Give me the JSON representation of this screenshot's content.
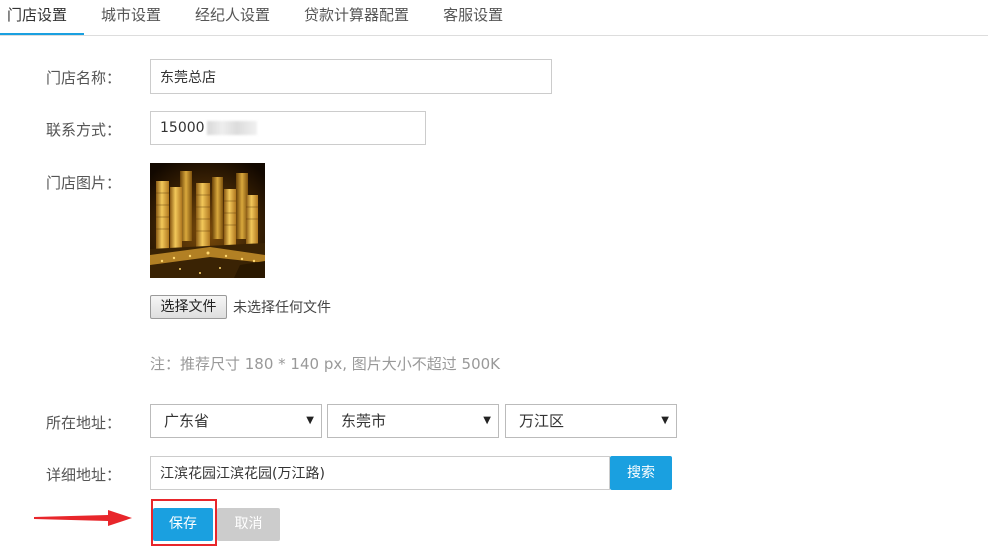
{
  "tabs": [
    {
      "label": "门店设置",
      "active": true
    },
    {
      "label": "城市设置",
      "active": false
    },
    {
      "label": "经纪人设置",
      "active": false
    },
    {
      "label": "贷款计算器配置",
      "active": false
    },
    {
      "label": "客服设置",
      "active": false
    }
  ],
  "form": {
    "store_name": {
      "label": "门店名称：",
      "value": "东莞总店"
    },
    "contact": {
      "label": "联系方式：",
      "value": "15000"
    },
    "photo": {
      "label": "门店图片："
    },
    "file": {
      "button_label": "选择文件",
      "status": "未选择任何文件"
    },
    "note": "注：推荐尺寸 180 * 140 px, 图片大小不超过 500K",
    "region": {
      "label": "所在地址：",
      "province": "广东省",
      "city": "东莞市",
      "district": "万江区"
    },
    "address": {
      "label": "详细地址：",
      "value": "江滨花园江滨花园(万江路)",
      "search_label": "搜索"
    },
    "actions": {
      "save_label": "保存",
      "cancel_label": "取消"
    }
  },
  "colors": {
    "accent": "#1aa0e0",
    "cancel": "#cccccc",
    "highlight": "#e8262b"
  }
}
